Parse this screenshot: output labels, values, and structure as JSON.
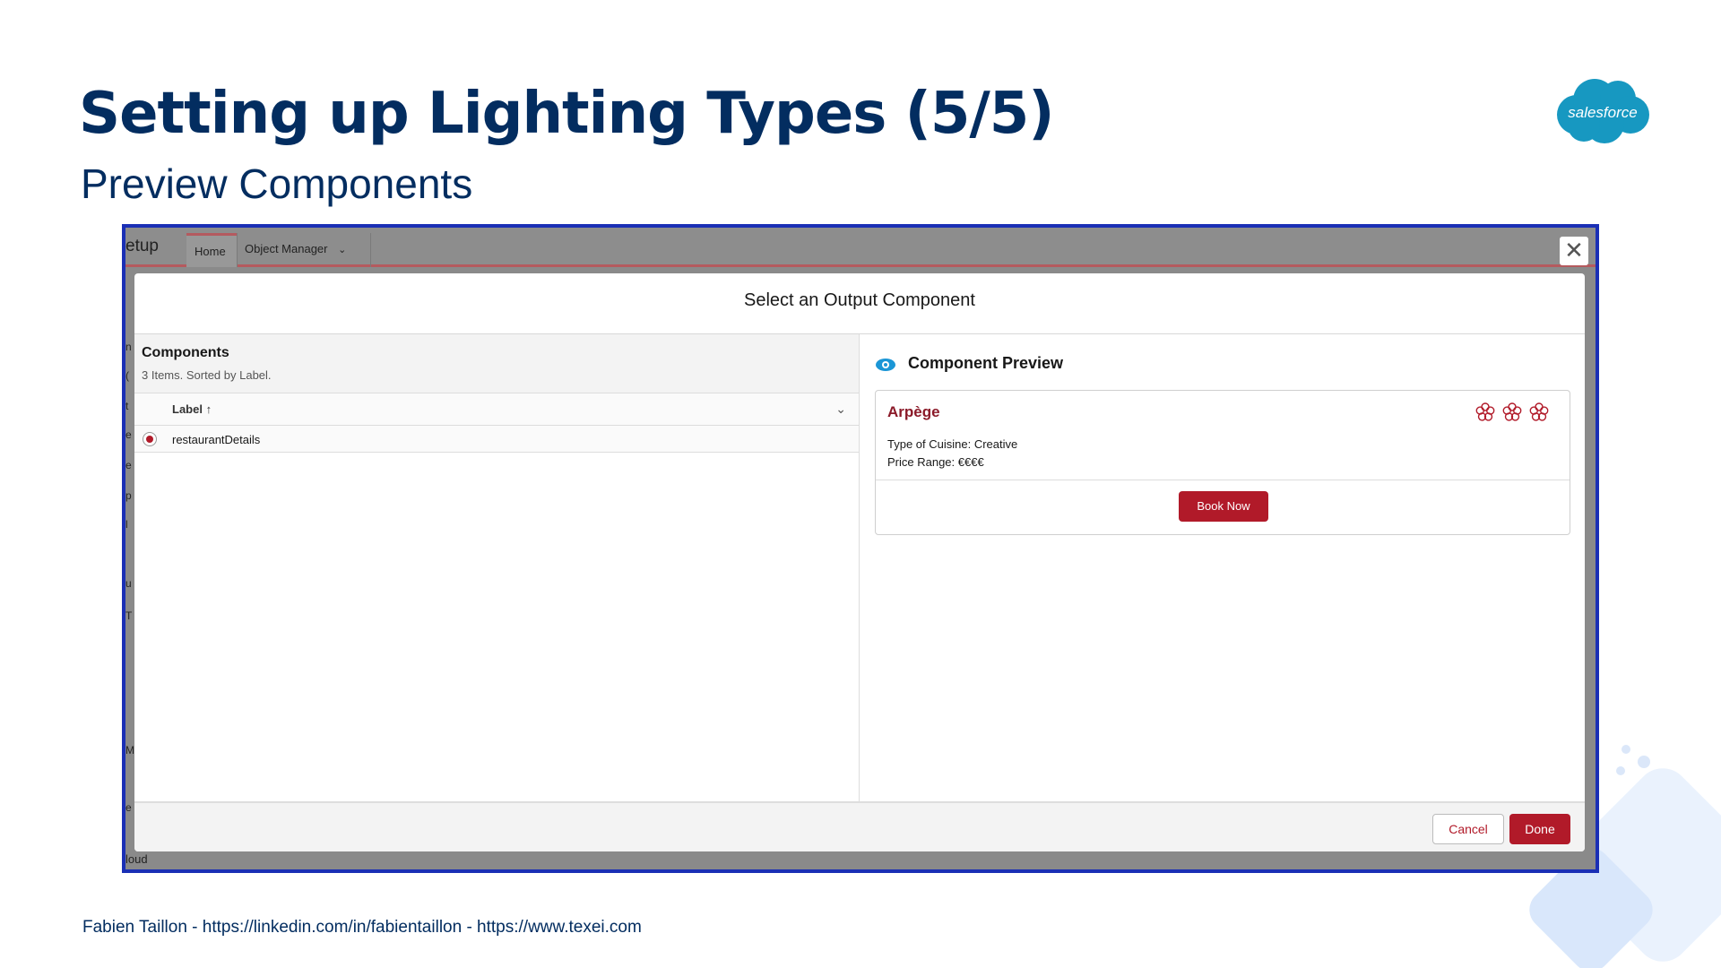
{
  "slide": {
    "title": "Setting up Lighting Types (5/5)",
    "subtitle": "Preview Components",
    "logo_text": "salesforce",
    "footer": "Fabien Taillon - https://linkedin.com/in/fabientaillon - https://www.texei.com"
  },
  "screenshot": {
    "setup_label": "etup",
    "tabs": [
      {
        "label": "Home"
      },
      {
        "label": "Object Manager"
      }
    ],
    "background_fragments": [
      "n",
      "(",
      "t",
      "e",
      "e",
      "p",
      "l",
      "u",
      "T",
      "M",
      "e"
    ],
    "background_cloud": "loud",
    "modal": {
      "title": "Select an Output Component",
      "components": {
        "title": "Components",
        "subtitle": "3 Items. Sorted by Label.",
        "column_label": "Label ↑",
        "rows": [
          {
            "label": "restaurantDetails",
            "selected": true
          }
        ]
      },
      "preview": {
        "title": "Component Preview",
        "card": {
          "name": "Arpège",
          "line1": "Type of Cuisine: Creative",
          "line2": "Price Range: €€€€",
          "stars": 3,
          "button": "Book Now"
        }
      },
      "footer": {
        "cancel": "Cancel",
        "done": "Done"
      }
    }
  },
  "colors": {
    "title": "#032d60",
    "accent_red": "#b11a29",
    "card_name": "#8b1a29",
    "frame_border": "#1a2fb5",
    "logo_blue": "#1798c1"
  }
}
